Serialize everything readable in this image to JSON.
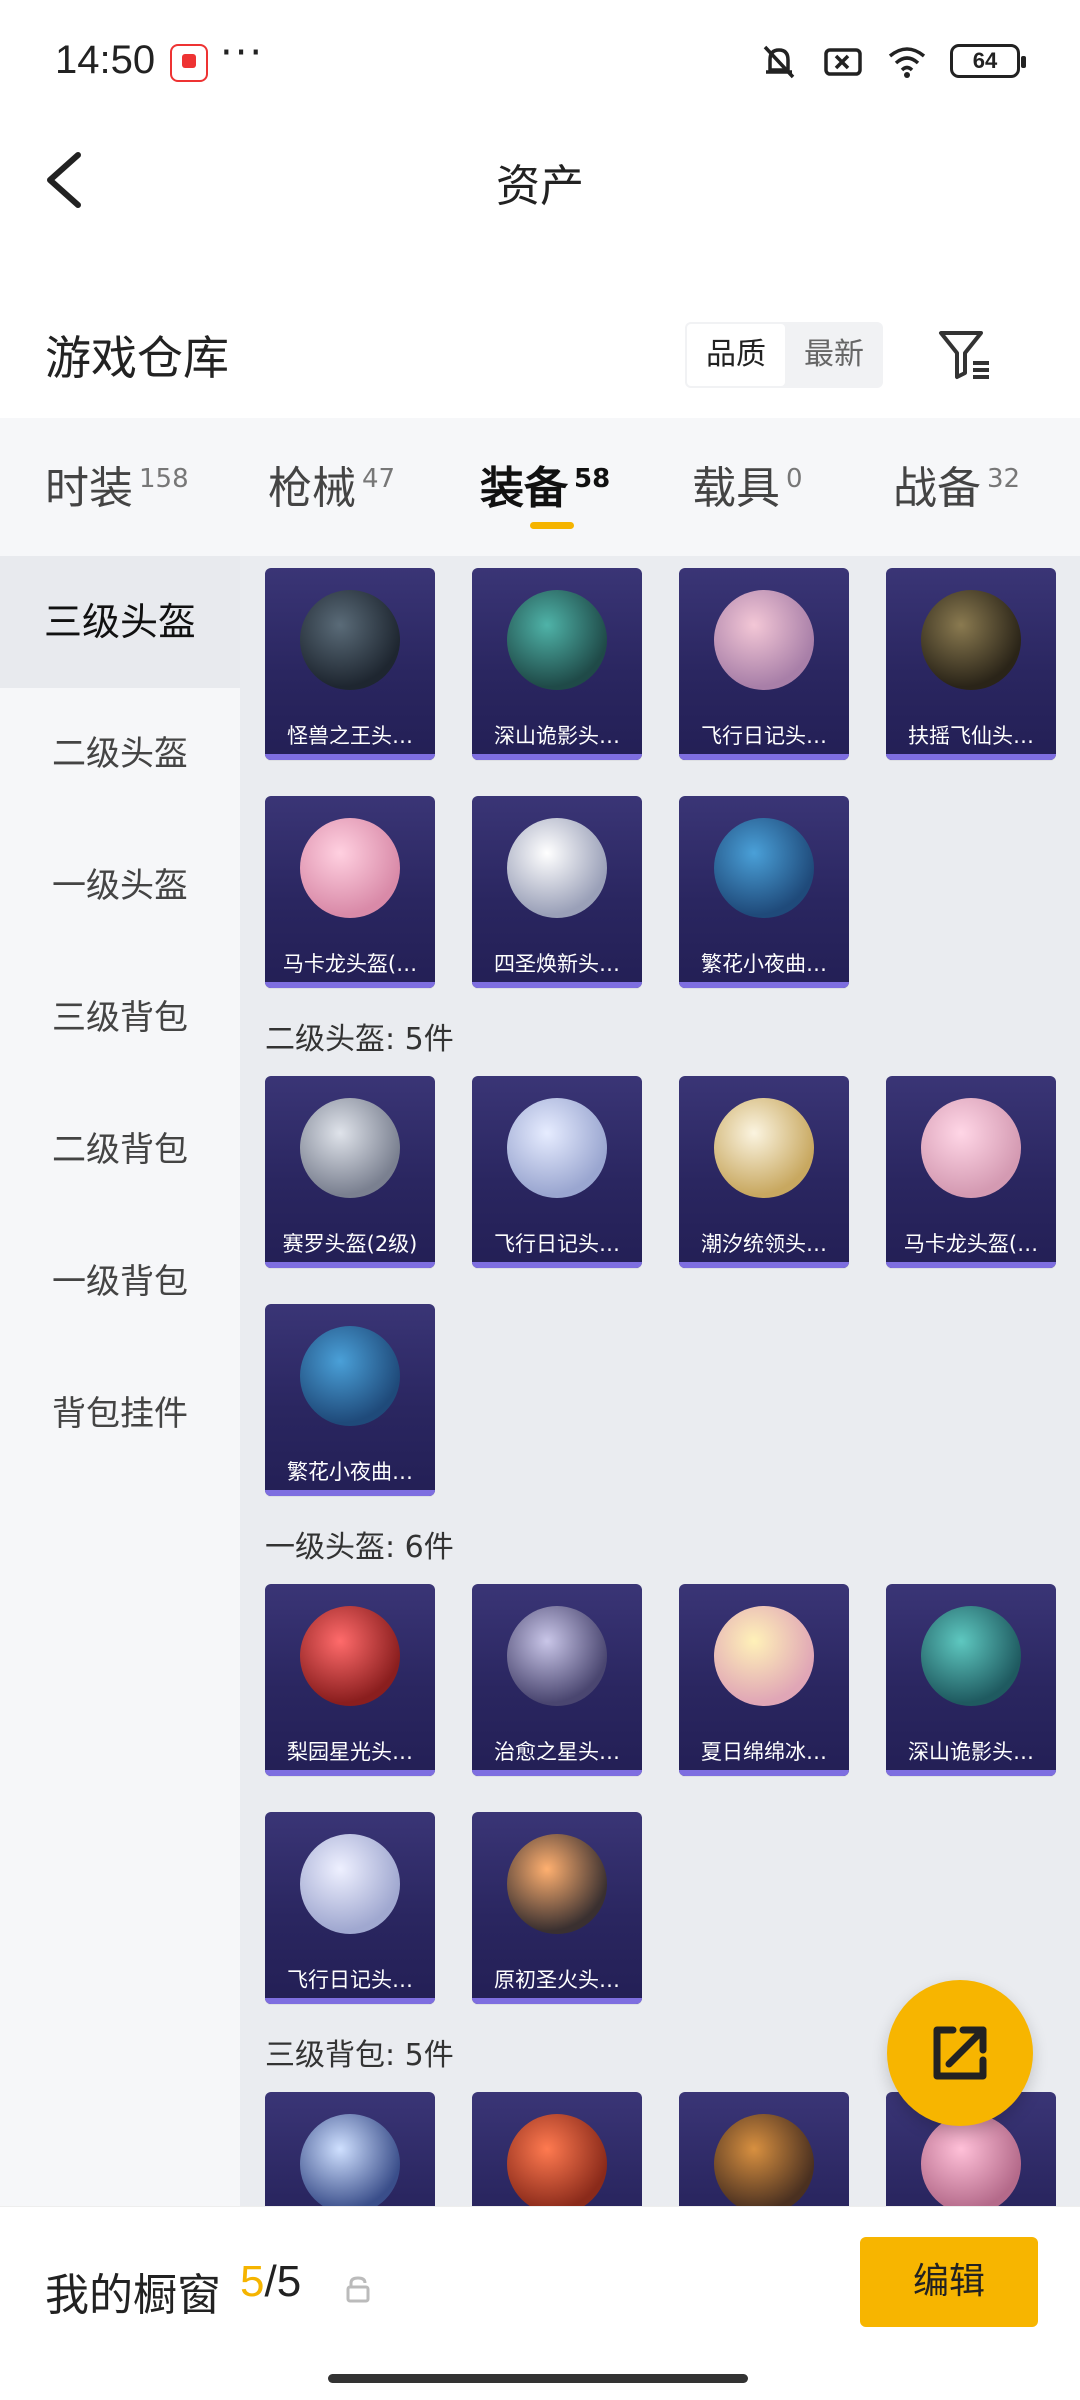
{
  "status": {
    "time": "14:50",
    "dots": "···",
    "battery": "64"
  },
  "header": {
    "title": "资产"
  },
  "warehouse": {
    "title": "游戏仓库",
    "sort_quality": "品质",
    "sort_newest": "最新"
  },
  "tabs": [
    {
      "label": "时装",
      "count": "158"
    },
    {
      "label": "枪械",
      "count": "47"
    },
    {
      "label": "装备",
      "count": "58"
    },
    {
      "label": "载具",
      "count": "0"
    },
    {
      "label": "战备",
      "count": "32"
    }
  ],
  "sidebar": [
    {
      "label": "三级头盔"
    },
    {
      "label": "二级头盔"
    },
    {
      "label": "一级头盔"
    },
    {
      "label": "三级背包"
    },
    {
      "label": "二级背包"
    },
    {
      "label": "一级背包"
    },
    {
      "label": "背包挂件"
    }
  ],
  "sections": [
    {
      "title": "",
      "items": [
        "怪兽之王头…",
        "深山诡影头…",
        "飞行日记头…",
        "扶摇飞仙头…",
        "马卡龙头盔(…",
        "四圣焕新头…",
        "繁花小夜曲…"
      ]
    },
    {
      "title": "二级头盔: 5件",
      "items": [
        "赛罗头盔(2级)",
        "飞行日记头…",
        "潮汐统领头…",
        "马卡龙头盔(…",
        "繁花小夜曲…"
      ]
    },
    {
      "title": "一级头盔: 6件",
      "items": [
        "梨园星光头…",
        "治愈之星头…",
        "夏日绵绵冰…",
        "深山诡影头…",
        "飞行日记头…",
        "原初圣火头…"
      ]
    },
    {
      "title": "三级背包: 5件",
      "items": [
        "",
        "",
        "",
        ""
      ]
    }
  ],
  "colors": {
    "accent": "#f5b400",
    "card_bg": "#2a2660",
    "card_bar": "#7e6ee0"
  },
  "bottom": {
    "label": "我的橱窗",
    "current": "5",
    "max": "/5",
    "edit": "编辑"
  }
}
